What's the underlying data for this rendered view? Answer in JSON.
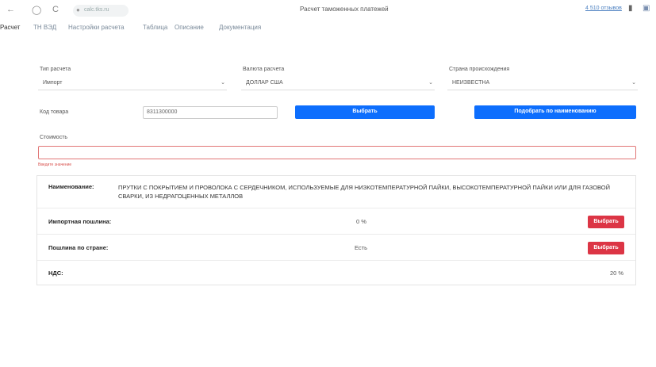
{
  "browser": {
    "back": "←",
    "forward": "→",
    "refresh": "C",
    "url": "calc.tks.ru",
    "page_title": "Расчет таможенных платежей",
    "reading_time": "4 510 отзывов"
  },
  "nav": {
    "brand": "Расчет",
    "items": [
      "ТН ВЭД",
      "Настройки расчета",
      "Таблица",
      "Описание",
      "Документация"
    ]
  },
  "form": {
    "calc_type_label": "Тип расчета",
    "calc_type_value": "Импорт",
    "currency_label": "Валюта расчета",
    "currency_value": "ДОЛЛАР США",
    "country_label": "Страна происхождения",
    "country_value": "НЕИЗВЕСТНА",
    "code_label": "Код товара",
    "code_value": "8311300000",
    "select_button": "Выбрать",
    "pick_by_name_button": "Подобрать по наименованию",
    "cost_label": "Стоимость",
    "cost_value": "",
    "cost_error": "Введите значение"
  },
  "result": {
    "name_label": "Наименование:",
    "name_value": "ПРУТКИ С ПОКРЫТИЕМ И ПРОВОЛОКА С СЕРДЕЧНИКОМ, ИСПОЛЬЗУЕМЫЕ ДЛЯ НИЗКОТЕМПЕРАТУРНОЙ ПАЙКИ, ВЫСОКОТЕМПЕРАТУРНОЙ ПАЙКИ ИЛИ ДЛЯ ГАЗОВОЙ СВАРКИ, ИЗ НЕДРАГОЦЕННЫХ МЕТАЛЛОВ",
    "import_duty_label": "Импортная пошлина:",
    "import_duty_value": "0 %",
    "import_duty_button": "Выбрать",
    "country_duty_label": "Пошлина по стране:",
    "country_duty_value": "Есть",
    "country_duty_button": "Выбрать",
    "vat_label": "НДС:",
    "vat_value": "20 %"
  },
  "colors": {
    "primary": "#0d6efd",
    "danger": "#dc3545",
    "error_border": "#e17676"
  }
}
